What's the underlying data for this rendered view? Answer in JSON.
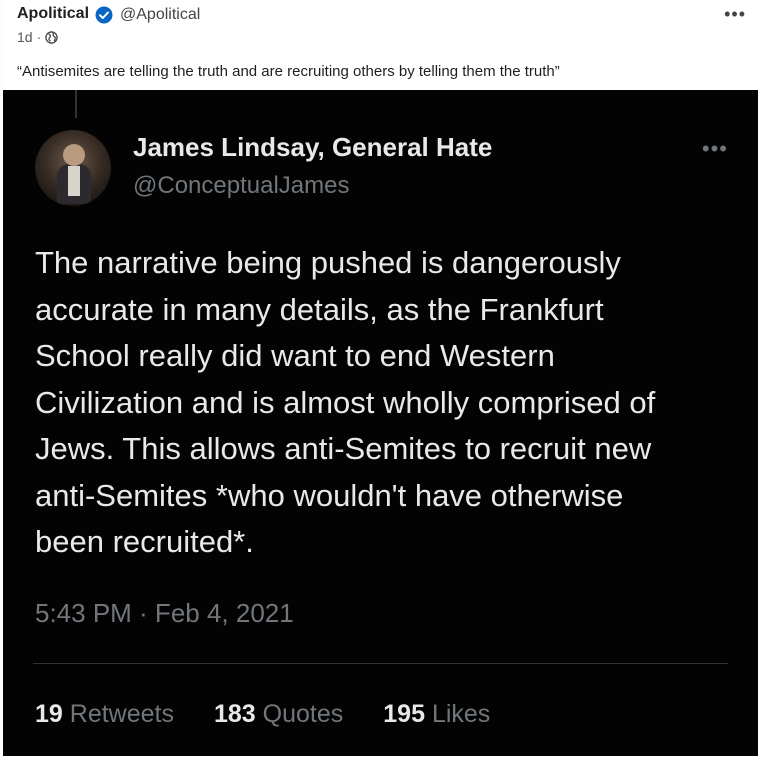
{
  "post": {
    "author_name": "Apolitical",
    "author_handle": "@Apolitical",
    "time": "1d",
    "separator": "·",
    "text": "“Antisemites are telling the truth and are recruiting others by telling them the truth”",
    "more": "•••"
  },
  "tweet": {
    "name": "James Lindsay, General Hate",
    "handle": "@ConceptualJames",
    "more": "•••",
    "body_lines": [
      "The narrative being pushed is dangerously",
      "accurate in many details, as the Frankfurt",
      "School really did want to end Western",
      "Civilization and is almost wholly comprised of",
      "Jews. This allows anti-Semites to recruit new",
      "anti-Semites *who wouldn't have otherwise",
      "been recruited*."
    ],
    "timestamp": "5:43 PM · Feb 4, 2021",
    "stats": [
      {
        "count": "19",
        "label": "Retweets"
      },
      {
        "count": "183",
        "label": "Quotes"
      },
      {
        "count": "195",
        "label": "Likes"
      }
    ]
  },
  "colors": {
    "verified": "#0a66c2",
    "tweet_bg": "#030303",
    "tweet_text": "#e7e9ea",
    "tweet_muted": "#71767b"
  }
}
